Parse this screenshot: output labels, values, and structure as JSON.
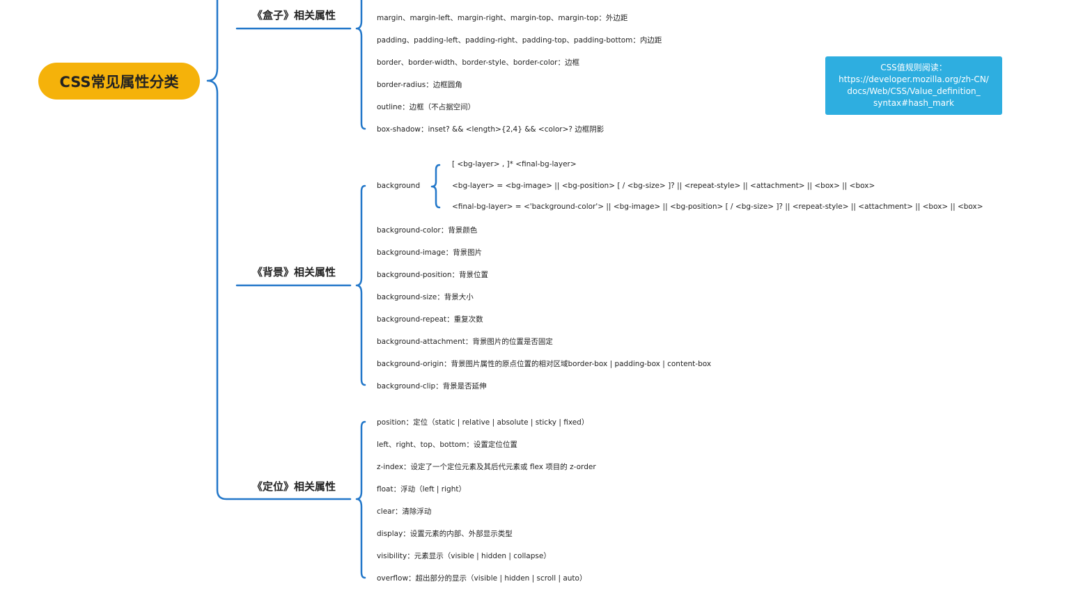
{
  "root": {
    "label": "CSS常见属性分类"
  },
  "categories": [
    {
      "label": "《盒子》相关属性",
      "items": [
        "margin、margin-left、margin-right、margin-top、margin-top：外边距",
        "padding、padding-left、padding-right、padding-top、padding-bottom：内边距",
        "border、border-width、border-style、border-color：边框",
        "border-radius：边框圆角",
        "outline：边框（不占据空间）",
        "box-shadow：inset? && <length>{2,4} && <color>? 边框阴影"
      ]
    },
    {
      "label": "《背景》相关属性",
      "background_label": "background",
      "background_syntax": [
        "[ <bg-layer> , ]* <final-bg-layer>",
        "<bg-layer> = <bg-image> || <bg-position> [ / <bg-size> ]? || <repeat-style> || <attachment> || <box> || <box>",
        "<final-bg-layer> = <'background-color'> || <bg-image> || <bg-position> [ / <bg-size> ]? || <repeat-style> || <attachment> || <box> || <box>"
      ],
      "items": [
        "background-color：背景颜色",
        "background-image：背景图片",
        "background-position：背景位置",
        "background-size：背景大小",
        "background-repeat：重复次数",
        "background-attachment：背景图片的位置是否固定",
        "background-origin：背景图片属性的原点位置的相对区域border-box | padding-box | content-box",
        "background-clip：背景是否延伸"
      ]
    },
    {
      "label": "《定位》相关属性",
      "items": [
        "position：定位（static | relative | absolute | sticky | fixed）",
        "left、right、top、bottom：设置定位位置",
        "z-index：设定了一个定位元素及其后代元素或 flex 项目的 z-order",
        "float：浮动（left | right）",
        "clear：清除浮动",
        "display：设置元素的内部、外部显示类型",
        "visibility：元素显示（visible | hidden | collapse）",
        "overflow：超出部分的显示（visible | hidden | scroll | auto）"
      ]
    }
  ],
  "note": {
    "lines": [
      "CSS值规则阅读：",
      "https://developer.mozilla.org/zh-CN/",
      "docs/Web/CSS/Value_definition_",
      "syntax#hash_mark"
    ]
  },
  "colors": {
    "connector": "#2277c9",
    "root_fill": "#f5b20a",
    "note_fill": "#2eaee0"
  }
}
